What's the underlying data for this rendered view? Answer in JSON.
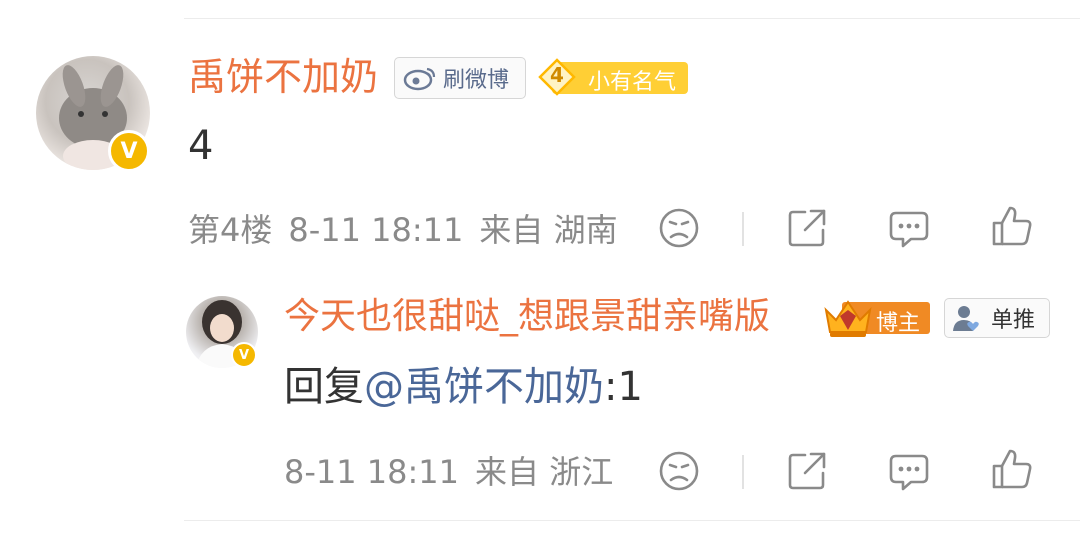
{
  "comment": {
    "username": "禹饼不加奶",
    "badge_weibo": "刷微博",
    "fame_level": "4",
    "fame_label": "小有名气",
    "verified_mark": "V",
    "content": "4",
    "floor": "第4楼",
    "time": "8-11 18:11",
    "source": "来自 湖南"
  },
  "reply": {
    "username": "今天也很甜哒_想跟景甜亲嘴版",
    "badge_bozhu": "博主",
    "badge_dantui": "单推",
    "verified_mark": "V",
    "reply_prefix": "回复",
    "mention": "@禹饼不加奶",
    "reply_text": ":1",
    "time": "8-11 18:11",
    "source": "来自 浙江"
  },
  "colors": {
    "username": "#eb7340",
    "mention": "#4a6798",
    "meta": "#8a8a8a",
    "fame_badge": "#ffcf35",
    "bozhu_badge": "#f08a24",
    "verified": "#f5b800"
  },
  "icons": [
    "dislike-icon",
    "share-icon",
    "comment-icon",
    "like-icon",
    "weibo-logo-icon",
    "crown-icon",
    "user-heart-icon"
  ]
}
